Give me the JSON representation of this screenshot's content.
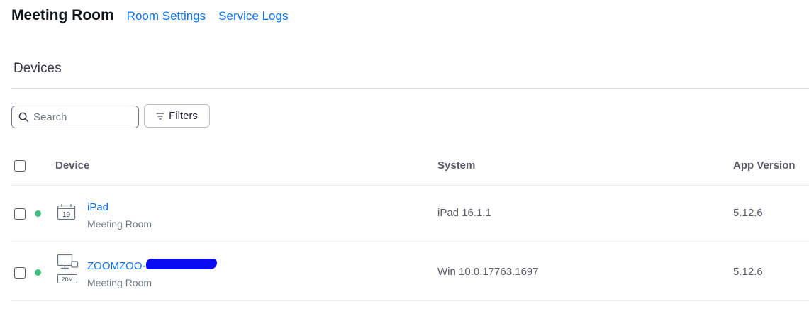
{
  "header": {
    "title": "Meeting Room",
    "links": [
      "Room Settings",
      "Service Logs"
    ]
  },
  "section": {
    "title": "Devices"
  },
  "toolbar": {
    "search_placeholder": "Search",
    "search_value": "",
    "filters_label": "Filters"
  },
  "table": {
    "columns": [
      "Device",
      "System",
      "App Version"
    ],
    "rows": [
      {
        "icon": "calendar-icon",
        "icon_text": "19",
        "name": "iPad",
        "subtitle": "Meeting Room",
        "status": "online",
        "system": "iPad 16.1.1",
        "version": "5.12.6"
      },
      {
        "icon": "computer-display-icon",
        "icon_text": "ZDM",
        "name": "ZOOMZOO-",
        "subtitle": "Meeting Room",
        "status": "online",
        "system": "Win 10.0.17763.1697",
        "version": "5.12.6"
      }
    ]
  },
  "colors": {
    "link": "#0e72ed",
    "status_online": "#3fbf7f",
    "redaction": "#0a0af0"
  }
}
